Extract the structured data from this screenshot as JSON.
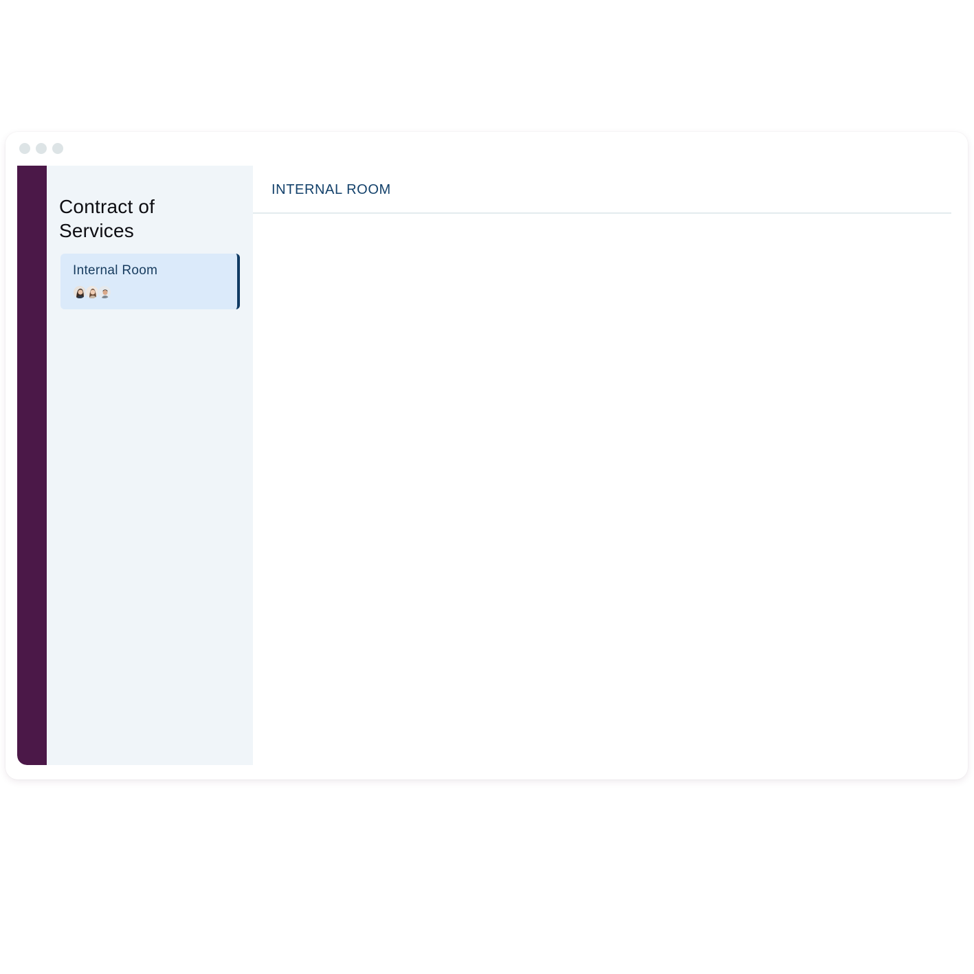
{
  "window": {
    "controls": [
      "window-dot",
      "window-dot",
      "window-dot"
    ]
  },
  "sidebar": {
    "title": "Contract of Services",
    "rooms": [
      {
        "name": "Internal Room",
        "selected": true,
        "participants": [
          "avatar-woman-1",
          "avatar-woman-2",
          "avatar-man"
        ]
      }
    ]
  },
  "main": {
    "header_title": "INTERNAL ROOM"
  },
  "colors": {
    "rail": "#4b1848",
    "sidebar_bg": "#f0f5f9",
    "selected_card_bg": "#dbeafa",
    "selected_card_border": "#0f3a63",
    "header_text": "#12406a"
  }
}
